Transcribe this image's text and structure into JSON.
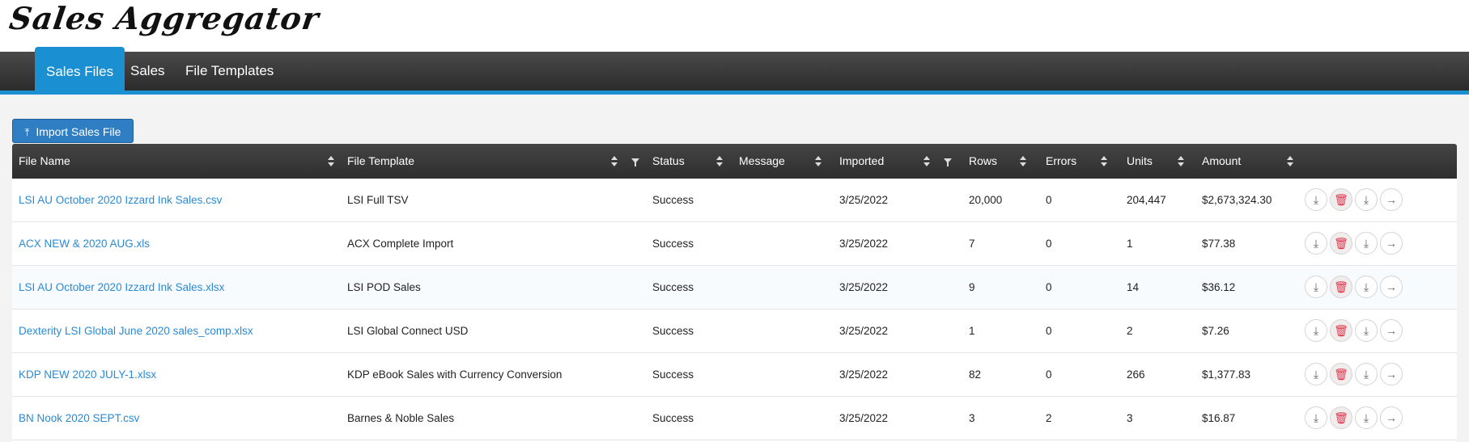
{
  "app": {
    "title": "Sales Aggregator"
  },
  "nav": {
    "tabs": [
      {
        "label": "Sales Files",
        "active": true
      },
      {
        "label": "Sales",
        "active": false
      },
      {
        "label": "File Templates",
        "active": false
      }
    ]
  },
  "toolbar": {
    "import_label": "Import Sales File",
    "import_icon": "upload-icon"
  },
  "grid": {
    "columns": [
      "File Name",
      "File Template",
      "Status",
      "Message",
      "Imported",
      "Rows",
      "Errors",
      "Units",
      "Amount"
    ],
    "rows": [
      {
        "file_name": "LSI AU October 2020 Izzard Ink Sales.csv",
        "template": "LSI Full TSV",
        "status": "Success",
        "message": "",
        "imported": "3/25/2022",
        "rows": "20,000",
        "errors": "0",
        "units": "204,447",
        "amount": "$2,673,324.30"
      },
      {
        "file_name": "ACX NEW & 2020 AUG.xls",
        "template": "ACX Complete Import",
        "status": "Success",
        "message": "",
        "imported": "3/25/2022",
        "rows": "7",
        "errors": "0",
        "units": "1",
        "amount": "$77.38"
      },
      {
        "file_name": "LSI AU October 2020 Izzard Ink Sales.xlsx",
        "template": "LSI POD Sales",
        "status": "Success",
        "message": "",
        "imported": "3/25/2022",
        "rows": "9",
        "errors": "0",
        "units": "14",
        "amount": "$36.12"
      },
      {
        "file_name": "Dexterity LSI Global June 2020 sales_comp.xlsx",
        "template": "LSI Global Connect USD",
        "status": "Success",
        "message": "",
        "imported": "3/25/2022",
        "rows": "1",
        "errors": "0",
        "units": "2",
        "amount": "$7.26"
      },
      {
        "file_name": "KDP NEW 2020 JULY-1.xlsx",
        "template": "KDP eBook Sales with Currency Conversion",
        "status": "Success",
        "message": "",
        "imported": "3/25/2022",
        "rows": "82",
        "errors": "0",
        "units": "266",
        "amount": "$1,377.83"
      },
      {
        "file_name": "BN Nook 2020 SEPT.csv",
        "template": "Barnes & Noble Sales",
        "status": "Success",
        "message": "",
        "imported": "3/25/2022",
        "rows": "3",
        "errors": "2",
        "units": "3",
        "amount": "$16.87"
      }
    ],
    "row_actions": [
      "download-icon",
      "trash-icon",
      "download-icon",
      "arrow-right-icon"
    ]
  },
  "colors": {
    "accent": "#1a8fd1",
    "link": "#2b8ad6",
    "delete": "#e0334a",
    "header": "#333333"
  }
}
